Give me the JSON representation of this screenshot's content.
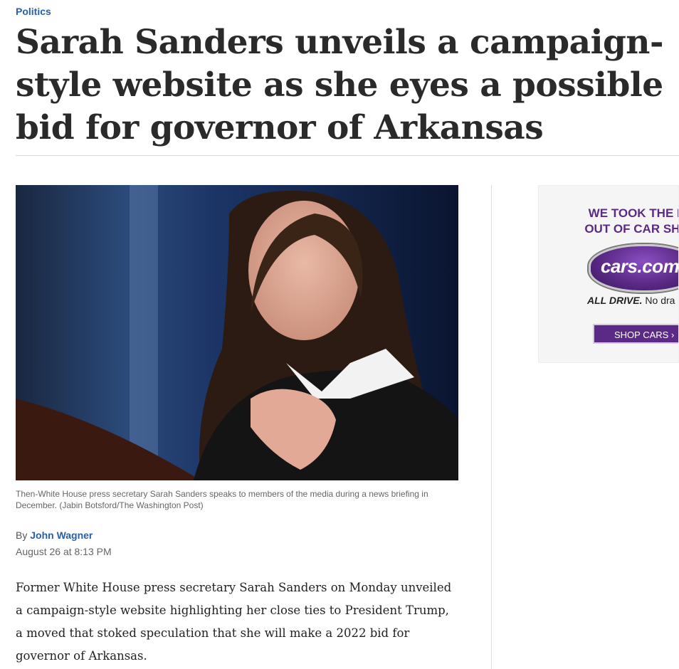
{
  "article": {
    "section": "Politics",
    "headline": "Sarah Sanders unveils a campaign-style website as she eyes a possible bid for governor of Arkansas",
    "caption": "Then-White House press secretary Sarah Sanders speaks to members of the media during a news briefing in December. (Jabin Botsford/The Washington Post)",
    "byline_prefix": "By",
    "author": "John Wagner",
    "date": "August 26 at 8:13 PM",
    "body": "Former White House press secretary Sarah Sanders on Monday unveiled a campaign-style website highlighting her close ties to President Trump, a moved that stoked speculation that she will make a 2022 bid for governor of Arkansas."
  },
  "ad": {
    "headline": "WE TOOK THE D\nOUT OF CAR SHO",
    "logo_text": "cars.com",
    "tagline_strong": "ALL DRIVE.",
    "tagline_rest": "No dra",
    "cta": "SHOP CARS ›"
  },
  "colors": {
    "link": "#2a5ea8",
    "ad_brand": "#5b2a86"
  }
}
